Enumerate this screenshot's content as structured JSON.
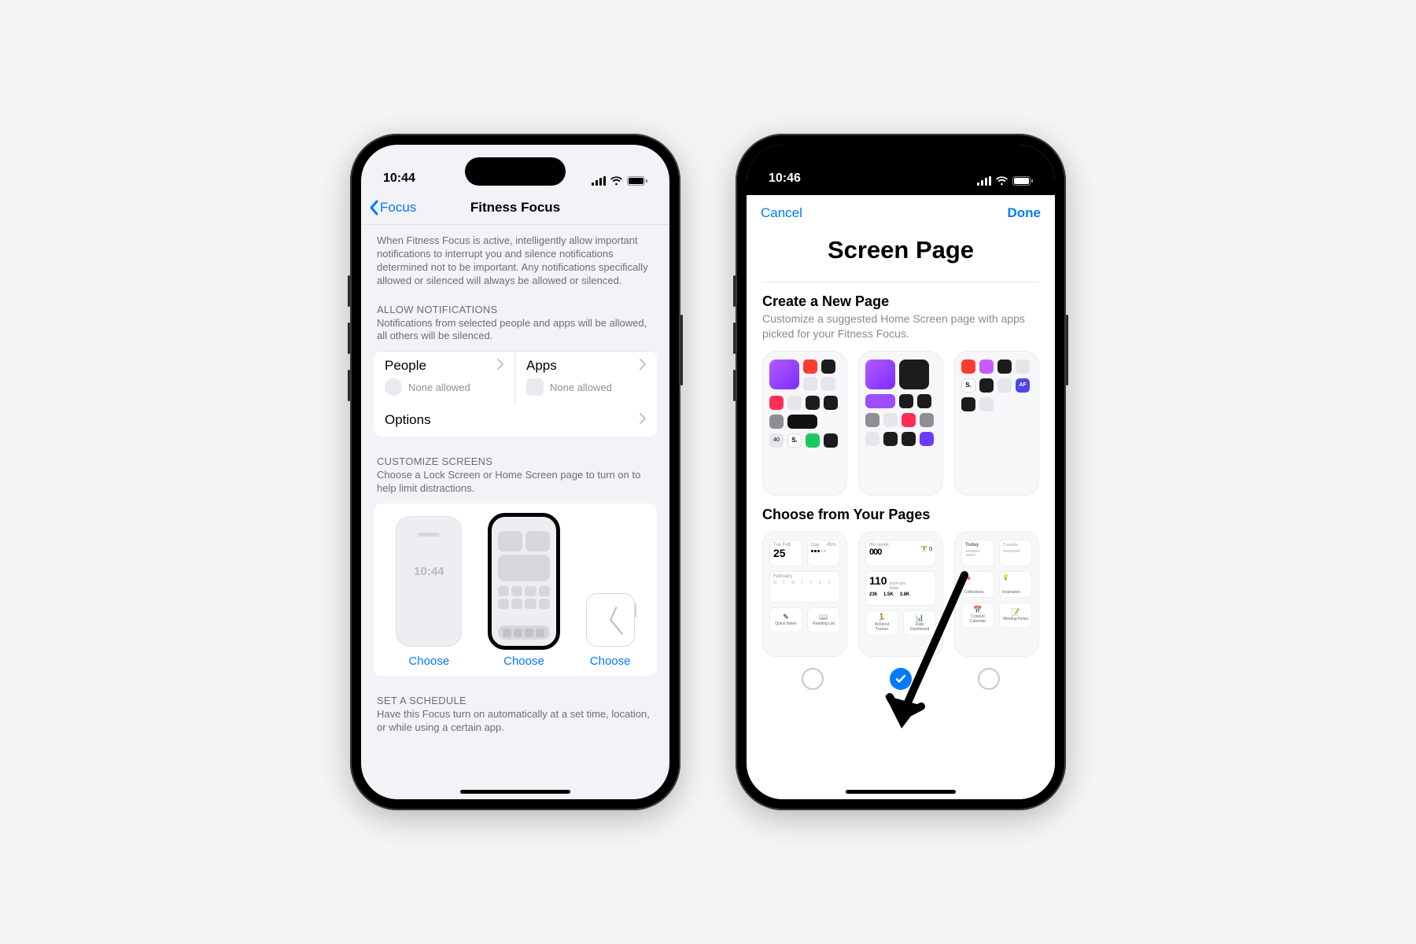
{
  "phone1": {
    "status_time": "10:44",
    "nav": {
      "back_label": "Focus",
      "title": "Fitness Focus"
    },
    "intro": "When Fitness Focus is active, intelligently allow important notifications to interrupt you and silence notifications determined not to be important. Any notifications specifically allowed or silenced will always be allowed or silenced.",
    "allow_notifications": {
      "header": "ALLOW NOTIFICATIONS",
      "sub": "Notifications from selected people and apps will be allowed, all others will be silenced.",
      "people_label": "People",
      "people_sub": "None allowed",
      "apps_label": "Apps",
      "apps_sub": "None allowed",
      "options_label": "Options"
    },
    "customize": {
      "header": "CUSTOMIZE SCREENS",
      "sub": "Choose a Lock Screen or Home Screen page to turn on to help limit distractions.",
      "lock_time": "10:44",
      "choose_label": "Choose"
    },
    "schedule": {
      "header": "SET A SCHEDULE",
      "sub": "Have this Focus turn on automatically at a set time, location, or while using a certain app."
    }
  },
  "phone2": {
    "status_time": "10:46",
    "sheet": {
      "cancel": "Cancel",
      "done": "Done",
      "title": "Screen Page",
      "create_title": "Create a New Page",
      "create_sub": "Customize a suggested Home Screen page with apps picked for your Fitness Focus.",
      "choose_title": "Choose from Your Pages",
      "page_selected_index": 1,
      "page_count": 3
    }
  }
}
